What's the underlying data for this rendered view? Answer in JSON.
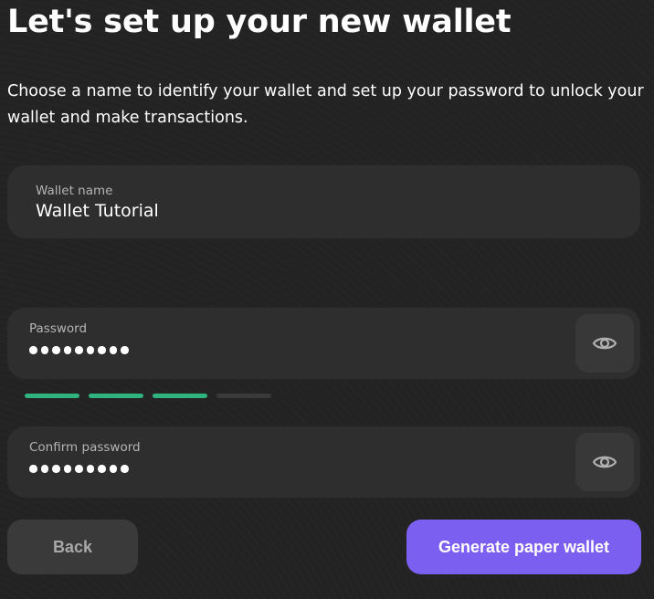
{
  "header": {
    "title": "Let's set up your new wallet",
    "subtitle": "Choose a name to identify your wallet and set up your password to unlock your wallet and make transactions."
  },
  "wallet_name": {
    "label": "Wallet name",
    "value": "Wallet Tutorial"
  },
  "password": {
    "label": "Password",
    "masked_length": 9,
    "toggle_icon": "eye-icon"
  },
  "strength_meter": {
    "segments_total": 4,
    "segments_filled": 3,
    "fill_color": "#2fb37f",
    "empty_color": "#3a3a3a"
  },
  "confirm_password": {
    "label": "Confirm password",
    "masked_length": 9,
    "toggle_icon": "eye-icon"
  },
  "actions": {
    "back_label": "Back",
    "generate_label": "Generate paper wallet",
    "accent_color": "#7b5ff0"
  }
}
